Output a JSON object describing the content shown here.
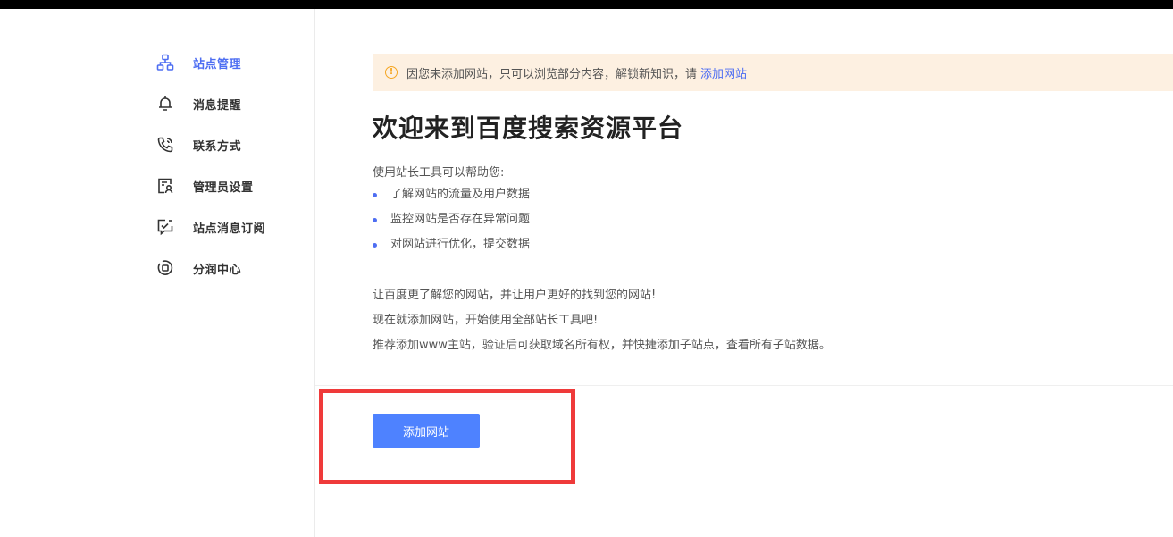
{
  "sidebar": {
    "items": [
      {
        "label": "站点管理",
        "icon": "sitemap-icon",
        "active": true
      },
      {
        "label": "消息提醒",
        "icon": "bell-icon",
        "active": false
      },
      {
        "label": "联系方式",
        "icon": "phone-icon",
        "active": false
      },
      {
        "label": "管理员设置",
        "icon": "admin-user-icon",
        "active": false
      },
      {
        "label": "站点消息订阅",
        "icon": "message-check-icon",
        "active": false
      },
      {
        "label": "分润中心",
        "icon": "coin-icon",
        "active": false
      }
    ]
  },
  "notice": {
    "text": "因您未添加网站，只可以浏览部分内容，解锁新知识，请",
    "link": "添加网站",
    "icon": "warning-icon"
  },
  "main": {
    "title": "欢迎来到百度搜索资源平台",
    "intro": "使用站长工具可以帮助您:",
    "bullets": [
      "了解网站的流量及用户数据",
      "监控网站是否存在异常问题",
      "对网站进行优化，提交数据"
    ],
    "desc": [
      "让百度更了解您的网站，并让用户更好的找到您的网站!",
      "现在就添加网站，开始使用全部站长工具吧!",
      "推荐添加www主站，验证后可获取域名所有权，并快捷添加子站点，查看所有子站数据。"
    ],
    "add_button": "添加网站"
  },
  "colors": {
    "accent": "#4e6ef2",
    "button": "#4e82ff",
    "notice_bg": "#fdf0e1",
    "warning": "#f5a623",
    "highlight": "#ef3a3a"
  }
}
